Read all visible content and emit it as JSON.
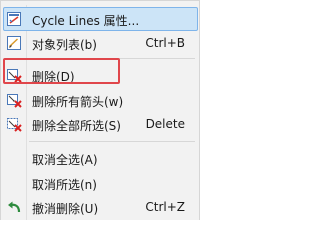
{
  "context_menu": {
    "items": [
      {
        "label": "Cycle Lines 属性...",
        "shortcut": "",
        "icon": "properties-icon"
      },
      {
        "label": "对象列表(b)",
        "shortcut": "Ctrl+B",
        "icon": "object-list-icon"
      },
      {
        "label": "删除(D)",
        "shortcut": "",
        "icon": "delete-icon"
      },
      {
        "label": "删除所有箭头(w)",
        "shortcut": "",
        "icon": "delete-all-arrows-icon"
      },
      {
        "label": "删除全部所选(S)",
        "shortcut": "Delete",
        "icon": "delete-all-selected-icon"
      },
      {
        "label": "取消全选(A)",
        "shortcut": "",
        "icon": ""
      },
      {
        "label": "取消所选(n)",
        "shortcut": "",
        "icon": ""
      },
      {
        "label": "撤消删除(U)",
        "shortcut": "Ctrl+Z",
        "icon": "undo-delete-icon"
      }
    ]
  },
  "colors": {
    "highlight_bg": "#cce4f7",
    "highlight_border": "#7eb4ea",
    "annotation": "#e0464b",
    "undo_arrow": "#2e8b3e"
  }
}
